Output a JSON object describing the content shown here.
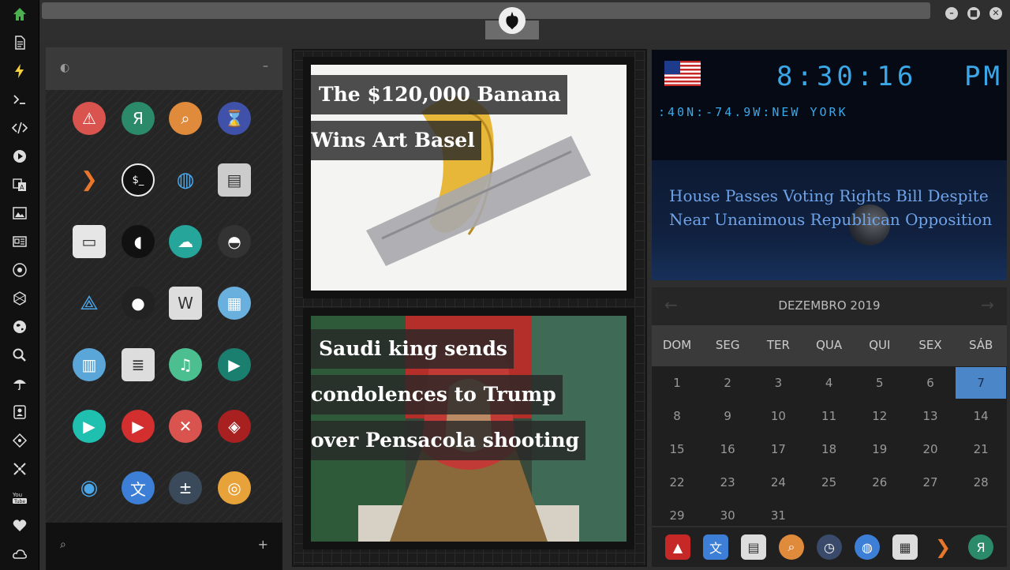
{
  "dock": {
    "icons": [
      "home-icon",
      "document-icon",
      "bolt-icon",
      "terminal-icon",
      "code-icon",
      "play-icon",
      "translate-icon",
      "image-icon",
      "news-icon",
      "rebel-icon",
      "network-icon",
      "globe-icon",
      "search-icon",
      "umbrella-icon",
      "contacts-icon",
      "git-icon",
      "crosshair-icon",
      "youtube-icon",
      "heart-icon",
      "cloud-icon"
    ]
  },
  "topbar": {
    "minimize": "–",
    "maximize": "■",
    "close": "✕"
  },
  "apppanel": {
    "header_left": "◐",
    "header_right": "–",
    "footer_search": "⌕",
    "footer_add": "+",
    "apps": [
      {
        "name": "warning-app",
        "glyph": "⚠",
        "color": "#d9534f"
      },
      {
        "name": "yandex-app",
        "glyph": "Я",
        "color": "#2a8a6a"
      },
      {
        "name": "search-app",
        "glyph": "⌕",
        "color": "#e08a3c"
      },
      {
        "name": "timer-app",
        "glyph": "⌛",
        "color": "#3f51a8"
      },
      {
        "name": "launcher-app",
        "glyph": "❯",
        "color": "transparent"
      },
      {
        "name": "terminal-app",
        "glyph": "$_",
        "color": "#111111"
      },
      {
        "name": "browser-app",
        "glyph": "◍",
        "color": "transparent"
      },
      {
        "name": "files-app",
        "glyph": "▤",
        "color": "#cccccc"
      },
      {
        "name": "window-app",
        "glyph": "▭",
        "color": "#e6e6e6"
      },
      {
        "name": "pacman-app",
        "glyph": "◖",
        "color": "#111111"
      },
      {
        "name": "cloud-lock-app",
        "glyph": "☁",
        "color": "#26a69a"
      },
      {
        "name": "github-app",
        "glyph": "◓",
        "color": "#333333"
      },
      {
        "name": "starfleet-app",
        "glyph": "⟁",
        "color": "transparent"
      },
      {
        "name": "deathstar-app",
        "glyph": "●",
        "color": "#222222"
      },
      {
        "name": "wikipedia-app",
        "glyph": "W",
        "color": "#dddddd"
      },
      {
        "name": "maps-app",
        "glyph": "▦",
        "color": "#6ab0de"
      },
      {
        "name": "books-app",
        "glyph": "▥",
        "color": "#5aa6d8"
      },
      {
        "name": "notes-app",
        "glyph": "≣",
        "color": "#dddddd"
      },
      {
        "name": "music-app",
        "glyph": "♫",
        "color": "#4bbf8f"
      },
      {
        "name": "video-app",
        "glyph": "▶",
        "color": "#1a7f6f"
      },
      {
        "name": "player-app",
        "glyph": "▶",
        "color": "#20c0b0"
      },
      {
        "name": "youtube-app",
        "glyph": "▶",
        "color": "#d32f2f"
      },
      {
        "name": "close-app",
        "glyph": "✕",
        "color": "#d9534f"
      },
      {
        "name": "ironman-app",
        "glyph": "◈",
        "color": "#a82020"
      },
      {
        "name": "c3po-app",
        "glyph": "◉",
        "color": "transparent"
      },
      {
        "name": "translate-app",
        "glyph": "文",
        "color": "#3d7fd6"
      },
      {
        "name": "calculator-app",
        "glyph": "±",
        "color": "#3a4a5a"
      },
      {
        "name": "photos-app",
        "glyph": "◎",
        "color": "#e8a23a"
      }
    ]
  },
  "news": {
    "card1_line1": "The $120,000 Banana",
    "card1_line2": "Wins Art Basel",
    "card2_line1": "Saudi king sends",
    "card2_line2": "condolences to Trump",
    "card2_line3": "over Pensacola shooting"
  },
  "clock": {
    "time": "8:30:16",
    "ampm": "PM",
    "coordinates": ":40N:-74.9W:NEW YORK",
    "headline": "House Passes Voting Rights Bill Despite Near Unanimous Republican Opposition"
  },
  "calendar": {
    "title": "DEZEMBRO 2019",
    "prev": "←",
    "next": "→",
    "weekdays": [
      "DOM",
      "SEG",
      "TER",
      "QUA",
      "QUI",
      "SEX",
      "SÁB"
    ],
    "first_weekday_index": 0,
    "days_in_month": 31,
    "selected_day": 7
  },
  "rdock": {
    "items": [
      {
        "name": "astro-icon",
        "glyph": "▲",
        "color": "#c62828"
      },
      {
        "name": "translate-icon",
        "glyph": "文",
        "color": "#3d7fd6"
      },
      {
        "name": "news-icon",
        "glyph": "▤",
        "color": "#dddddd"
      },
      {
        "name": "search-icon",
        "glyph": "⌕",
        "color": "#e08a3c"
      },
      {
        "name": "clock-icon",
        "glyph": "◷",
        "color": "#3a4a6a"
      },
      {
        "name": "globe-icon",
        "glyph": "◍",
        "color": "#3d7fd6"
      },
      {
        "name": "calendar-icon",
        "glyph": "▦",
        "color": "#dddddd"
      },
      {
        "name": "launcher-icon",
        "glyph": "❯",
        "color": "transparent"
      },
      {
        "name": "yandex-icon",
        "glyph": "Я",
        "color": "#2a8a6a"
      }
    ]
  }
}
